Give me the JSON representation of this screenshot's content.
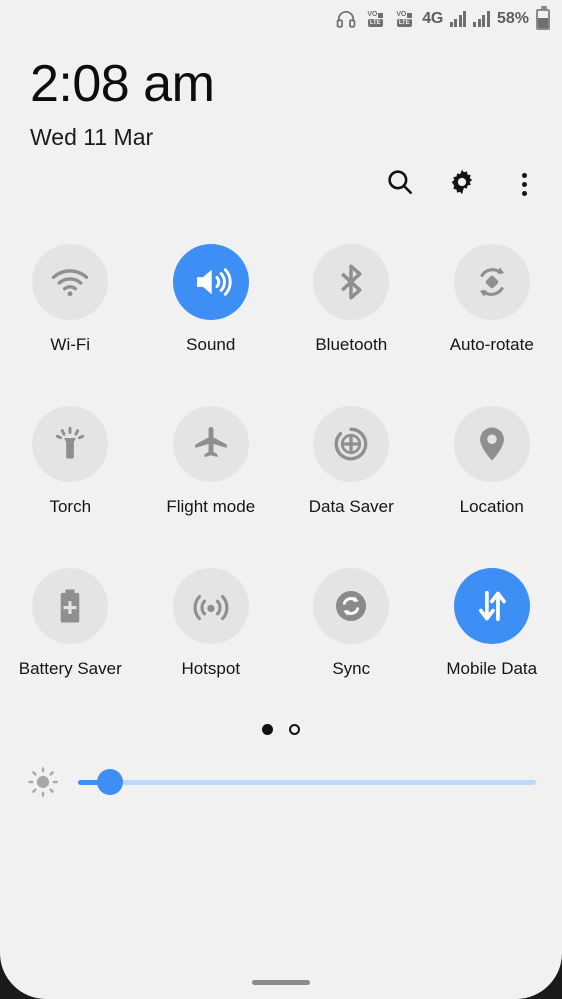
{
  "statusbar": {
    "headset_icon": "headset-icon",
    "volte_slots": [
      "VoLTE",
      "VoLTE"
    ],
    "volte_primary_text": "VO",
    "volte_secondary_text": "LTE",
    "network_type": "4G",
    "signal_bars": [
      4,
      4
    ],
    "battery_percent": "58%",
    "battery_level": 58
  },
  "clock": {
    "time": "2:08 am",
    "date": "Wed 11 Mar"
  },
  "actions": [
    {
      "name": "search",
      "icon": "search-icon"
    },
    {
      "name": "settings",
      "icon": "gear-icon"
    },
    {
      "name": "more",
      "icon": "more-vertical-icon"
    }
  ],
  "tiles": [
    {
      "label": "Wi-Fi",
      "icon": "wifi-icon",
      "active": false
    },
    {
      "label": "Sound",
      "icon": "volume-icon",
      "active": true
    },
    {
      "label": "Bluetooth",
      "icon": "bluetooth-icon",
      "active": false
    },
    {
      "label": "Auto-rotate",
      "icon": "auto-rotate-icon",
      "active": false
    },
    {
      "label": "Torch",
      "icon": "flashlight-icon",
      "active": false
    },
    {
      "label": "Flight mode",
      "icon": "airplane-icon",
      "active": false
    },
    {
      "label": "Data Saver",
      "icon": "data-saver-icon",
      "active": false
    },
    {
      "label": "Location",
      "icon": "location-pin-icon",
      "active": false
    },
    {
      "label": "Battery Saver",
      "icon": "battery-plus-icon",
      "active": false
    },
    {
      "label": "Hotspot",
      "icon": "hotspot-icon",
      "active": false
    },
    {
      "label": "Sync",
      "icon": "sync-icon",
      "active": false
    },
    {
      "label": "Mobile Data",
      "icon": "mobile-data-icon",
      "active": true
    }
  ],
  "pager": {
    "total": 2,
    "current": 1
  },
  "brightness": {
    "icon": "brightness-icon",
    "value": 7,
    "min": 0,
    "max": 100
  },
  "navigation": {
    "home_indicator": "home-indicator"
  },
  "colors": {
    "accent": "#3d8ef5",
    "tile_off": "#e4e4e4",
    "panel_bg": "#f1f1f1",
    "track": "#bcd8fb",
    "icon_gray": "#8f8f8f",
    "text": "#151515"
  }
}
